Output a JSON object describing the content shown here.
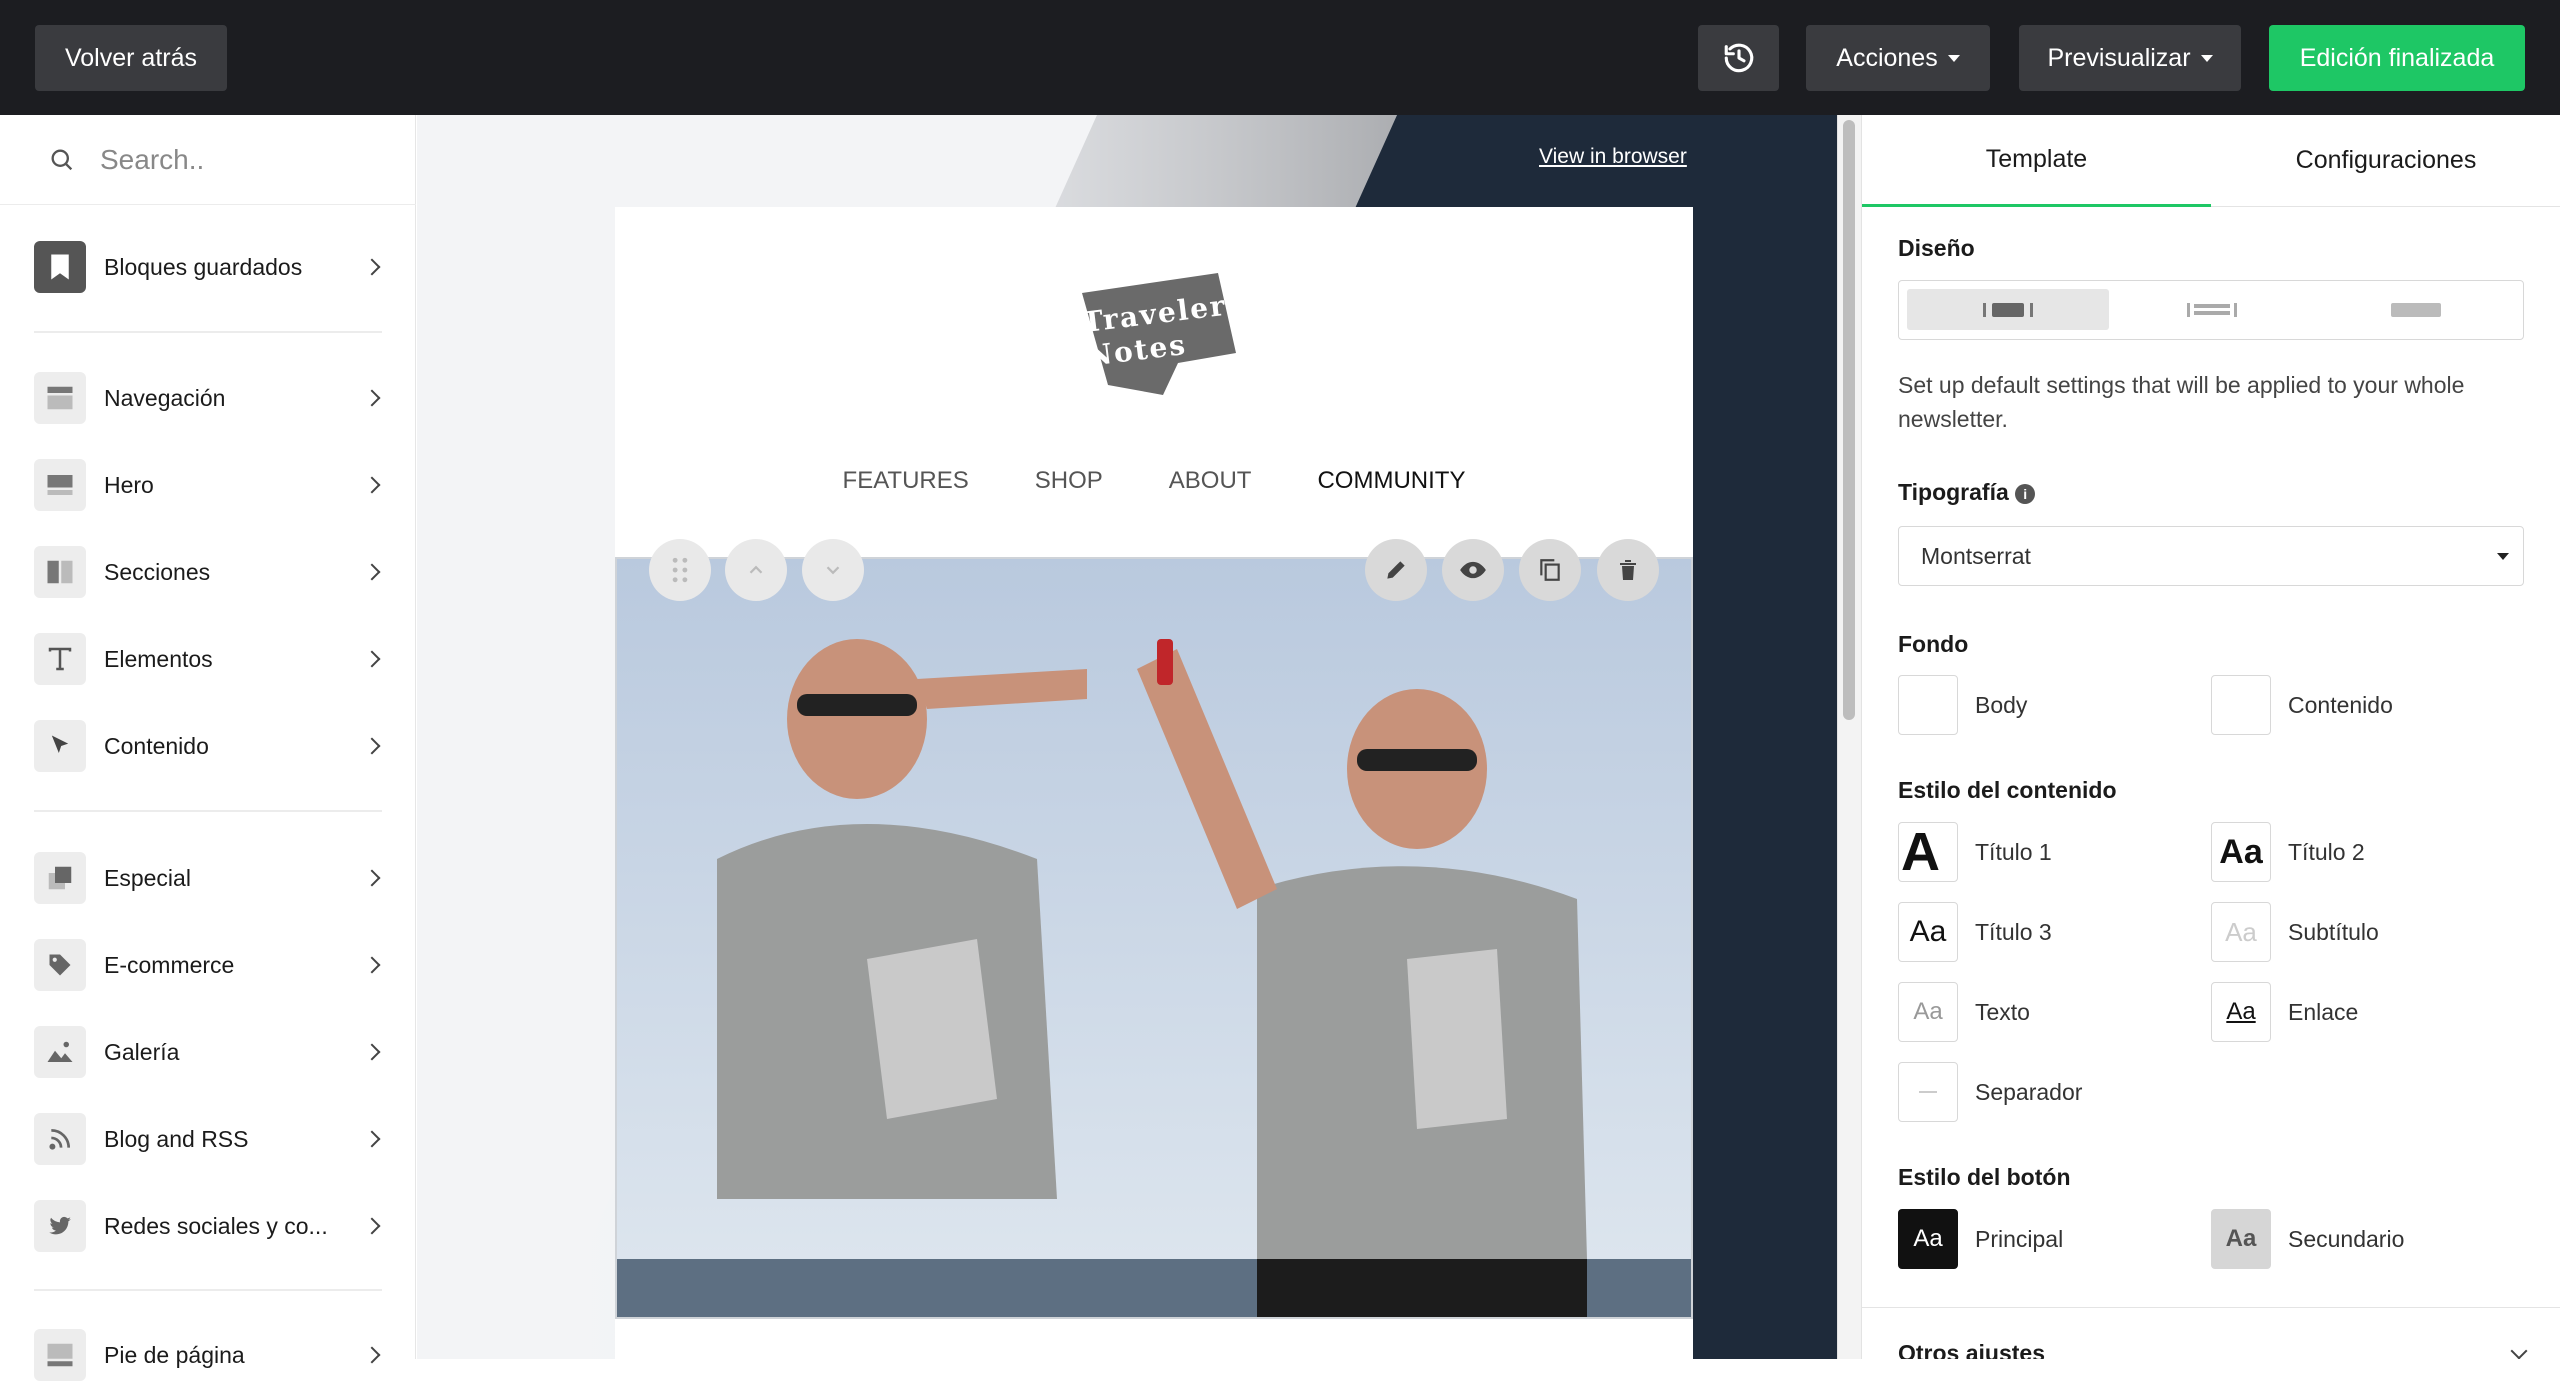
{
  "topbar": {
    "back_label": "Volver atrás",
    "history_icon": "history-icon",
    "actions_label": "Acciones",
    "preview_label": "Previsualizar",
    "finish_label": "Edición finalizada",
    "finish_color": "#1ec765"
  },
  "sidebar": {
    "search_placeholder": "Search..",
    "items": [
      {
        "label": "Bloques guardados",
        "icon": "bookmark-icon"
      },
      {
        "label": "Navegación",
        "icon": "navigation-block-icon"
      },
      {
        "label": "Hero",
        "icon": "hero-block-icon"
      },
      {
        "label": "Secciones",
        "icon": "sections-icon"
      },
      {
        "label": "Elementos",
        "icon": "text-t-icon"
      },
      {
        "label": "Contenido",
        "icon": "cursor-icon"
      },
      {
        "label": "Especial",
        "icon": "special-stack-icon"
      },
      {
        "label": "E-commerce",
        "icon": "tag-icon"
      },
      {
        "label": "Galería",
        "icon": "image-icon"
      },
      {
        "label": "Blog and RSS",
        "icon": "rss-icon"
      },
      {
        "label": "Redes sociales y co...",
        "icon": "twitter-icon"
      },
      {
        "label": "Pie de página",
        "icon": "footer-block-icon"
      }
    ]
  },
  "canvas": {
    "view_in_browser": "View in browser",
    "logo_line1": "Traveler",
    "logo_line2": "Notes",
    "nav": [
      "FEATURES",
      "SHOP",
      "ABOUT",
      "COMMUNITY"
    ],
    "dark_band_color": "#1e2a3a"
  },
  "right_panel": {
    "tabs": [
      "Template",
      "Configuraciones"
    ],
    "active_tab": "Template",
    "accent_color": "#1ec765",
    "design_title": "Diseño",
    "design_description": "Set up default settings that will be applied to your whole newsletter.",
    "typography_title": "Tipografía",
    "typography_value": "Montserrat",
    "background_title": "Fondo",
    "background": [
      "Body",
      "Contenido"
    ],
    "content_style_title": "Estilo del contenido",
    "content_styles": [
      "Título 1",
      "Título 2",
      "Título 3",
      "Subtítulo",
      "Texto",
      "Enlace",
      "Separador"
    ],
    "swatch_glyph": "Aa",
    "swatch_glyph_cut": "A",
    "button_style_title": "Estilo del botón",
    "button_styles": [
      "Principal",
      "Secundario"
    ],
    "other_settings": "Otros ajustes"
  }
}
